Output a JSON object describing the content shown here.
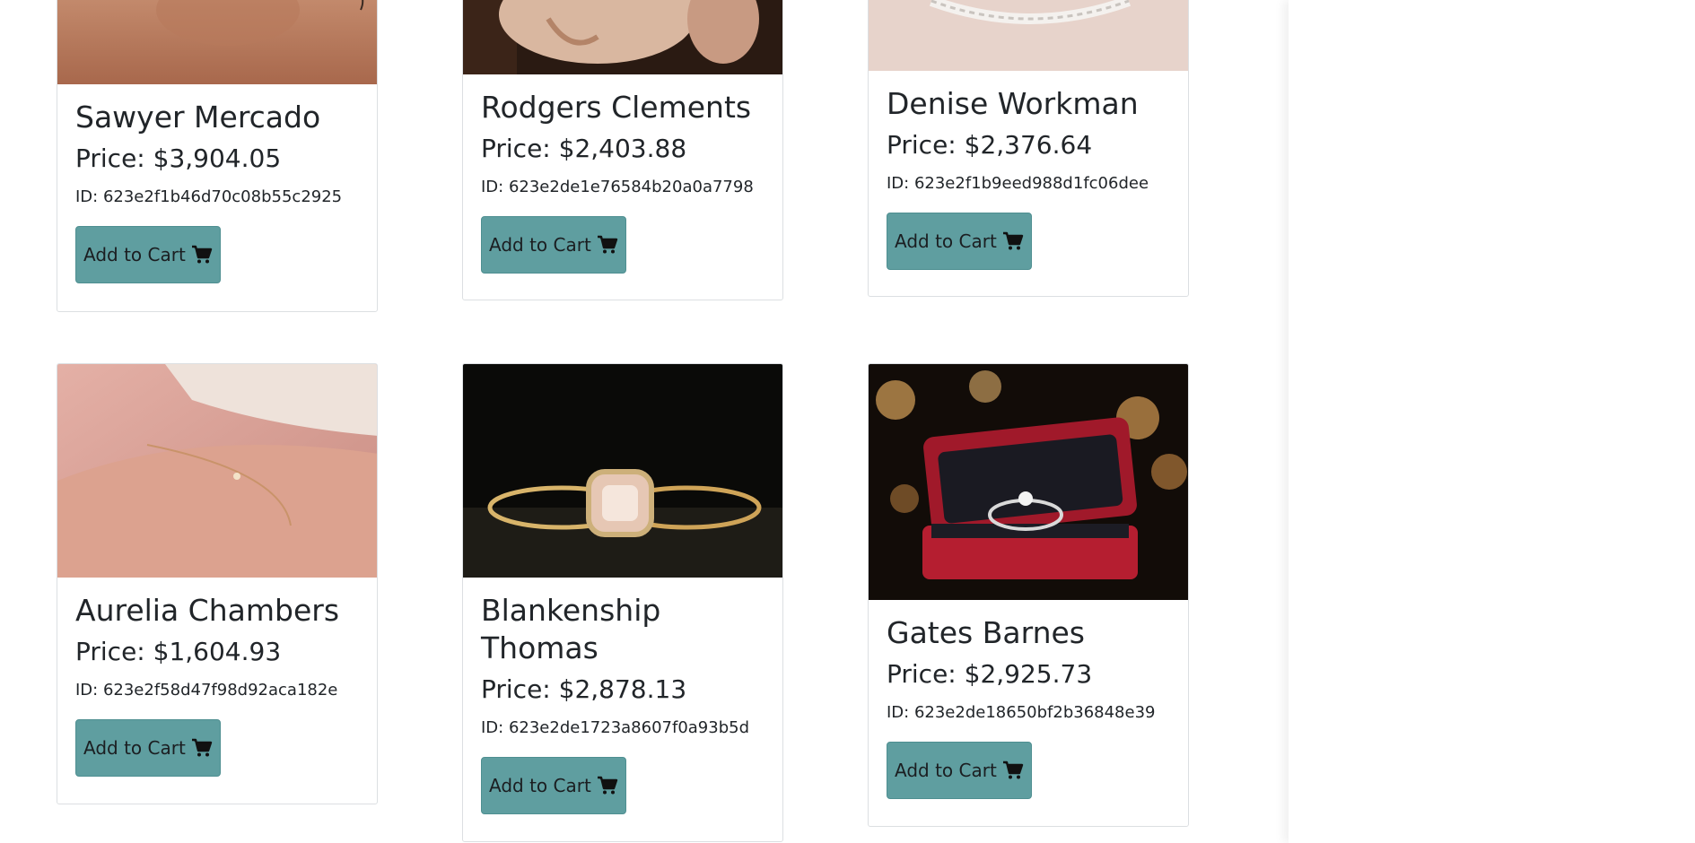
{
  "products": [
    {
      "name": "Sawyer Mercado",
      "price": "Price: $3,904.05",
      "id": "ID: 623e2f1b46d70c08b55c2925",
      "button": "Add to Cart",
      "icon": "cart-icon"
    },
    {
      "name": "Rodgers Clements",
      "price": "Price: $2,403.88",
      "id": "ID: 623e2de1e76584b20a0a7798",
      "button": "Add to Cart",
      "icon": "cart-icon"
    },
    {
      "name": "Denise Workman",
      "price": "Price: $2,376.64",
      "id": "ID: 623e2f1b9eed988d1fc06dee",
      "button": "Add to Cart",
      "icon": "cart-icon"
    },
    {
      "name": "Aurelia Chambers",
      "price": "Price: $1,604.93",
      "id": "ID: 623e2f58d47f98d92aca182e",
      "button": "Add to Cart",
      "icon": "cart-icon"
    },
    {
      "name": "Blankenship Thomas",
      "price": "Price: $2,878.13",
      "id": "ID: 623e2de1723a8607f0a93b5d",
      "button": "Add to Cart",
      "icon": "cart-icon"
    },
    {
      "name": "Gates Barnes",
      "price": "Price: $2,925.73",
      "id": "ID: 623e2de18650bf2b36848e39",
      "button": "Add to Cart",
      "icon": "cart-icon"
    }
  ],
  "colors": {
    "button": "#5f9ea0",
    "text": "#212529"
  }
}
